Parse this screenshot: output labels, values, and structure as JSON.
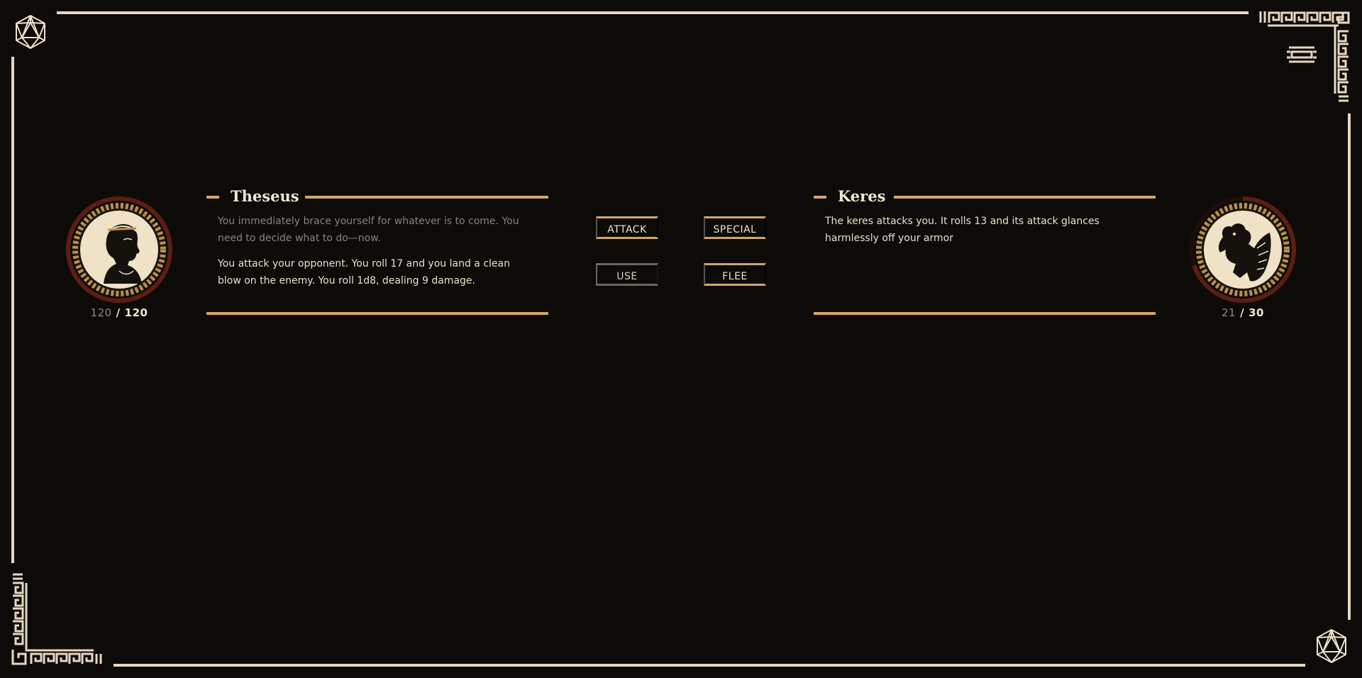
{
  "player": {
    "name": "Theseus",
    "hp_current": "120",
    "hp_separator": "/",
    "hp_max": "120",
    "hp_fraction": 1.0,
    "log": [
      "You immediately brace yourself for whatever is to come. You need to decide what to do—now.",
      "You attack your opponent. You roll 17 and you land a clean blow on the enemy. You roll 1d8, dealing 9 damage."
    ]
  },
  "enemy": {
    "name": "Keres",
    "hp_current": "21",
    "hp_separator": "/",
    "hp_max": "30",
    "hp_fraction": 0.7,
    "log": [
      "The keres attacks you. It rolls 13 and its attack glances harmlessly off your armor"
    ]
  },
  "actions": {
    "attack": "ATTACK",
    "special": "SPECIAL",
    "use": "USE",
    "flee": "FLEE"
  },
  "icons": {
    "corner_dice": "d20-icon",
    "menu": "menu-icon",
    "corner_ornament": "greek-key-ornament"
  },
  "colors": {
    "background": "#0d0b08",
    "frame": "#e6d7bf",
    "accent": "#d4a46c",
    "hp_ring": "#5a1f12",
    "text": "#eadfca",
    "text_dim": "#8a8375",
    "disabled_border": "#6b665e"
  }
}
